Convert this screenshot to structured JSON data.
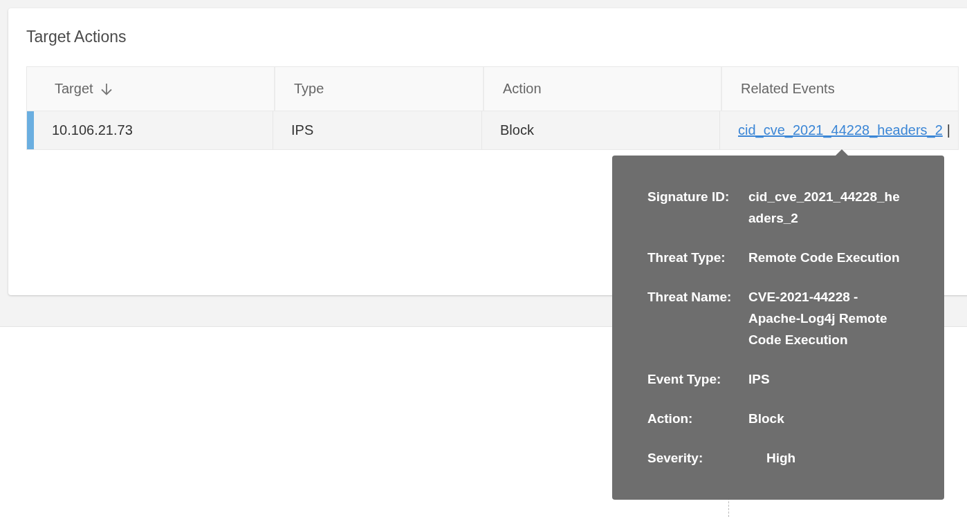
{
  "card": {
    "title": "Target Actions",
    "table": {
      "columns": [
        {
          "label": "Target",
          "sorted": true
        },
        {
          "label": "Type",
          "sorted": false
        },
        {
          "label": "Action",
          "sorted": false
        },
        {
          "label": "Related Events",
          "sorted": false
        }
      ],
      "rows": [
        {
          "selected": true,
          "target": "10.106.21.73",
          "type": "IPS",
          "action": "Block",
          "related_events": [
            {
              "kind": "link",
              "text": "cid_cve_2021_44228_headers_2"
            },
            {
              "kind": "separator",
              "text": "|"
            }
          ]
        }
      ]
    }
  },
  "tooltip": {
    "fields": [
      {
        "kind": "text",
        "label": "Signature ID:",
        "value": "cid_cve_2021_44228_headers_2"
      },
      {
        "kind": "text",
        "label": "Threat Type:",
        "value": "Remote Code Execution"
      },
      {
        "kind": "text",
        "label": "Threat Name:",
        "value": "CVE-2021-44228 - Apache-Log4j Remote Code Execution"
      },
      {
        "kind": "text",
        "label": "Event Type:",
        "value": "IPS"
      },
      {
        "kind": "text",
        "label": "Action:",
        "value": "Block"
      },
      {
        "kind": "severity",
        "label": "Severity:",
        "value": "High"
      }
    ]
  }
}
